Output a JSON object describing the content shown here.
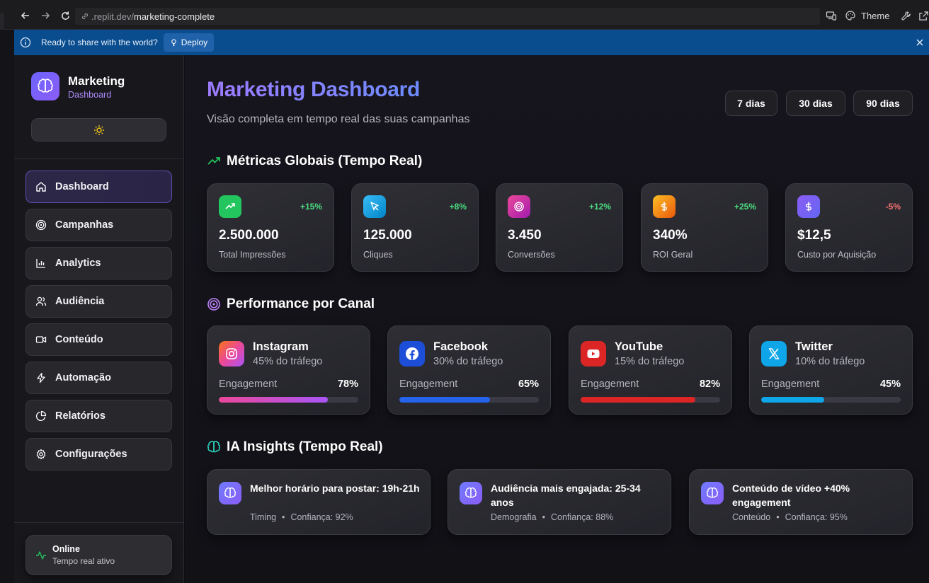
{
  "browser": {
    "url_prefix": ".replit.dev/",
    "url_path": "marketing-complete",
    "theme_label": "Theme"
  },
  "deploy_bar": {
    "message": "Ready to share with the world?",
    "button": "Deploy"
  },
  "sidebar": {
    "brand_title": "Marketing",
    "brand_subtitle": "Dashboard",
    "items": [
      {
        "label": "Dashboard",
        "icon": "home-icon",
        "active": true
      },
      {
        "label": "Campanhas",
        "icon": "target-icon"
      },
      {
        "label": "Analytics",
        "icon": "bar-chart-icon"
      },
      {
        "label": "Audiência",
        "icon": "users-icon"
      },
      {
        "label": "Conteúdo",
        "icon": "video-icon"
      },
      {
        "label": "Automação",
        "icon": "lightning-icon"
      },
      {
        "label": "Relatórios",
        "icon": "pie-chart-icon"
      },
      {
        "label": "Configurações",
        "icon": "gear-icon"
      }
    ],
    "status": {
      "title": "Online",
      "subtitle": "Tempo real ativo"
    }
  },
  "header": {
    "title": "Marketing Dashboard",
    "subtitle": "Visão completa em tempo real das suas campanhas",
    "ranges": [
      "7 dias",
      "30 dias",
      "90 dias"
    ]
  },
  "metrics": {
    "title": "Métricas Globais (Tempo Real)",
    "cards": [
      {
        "value": "2.500.000",
        "label": "Total Impressões",
        "change": "+15%",
        "icon": "trending-up-icon",
        "color": "#22c55e",
        "change_color": "#4ade80"
      },
      {
        "value": "125.000",
        "label": "Cliques",
        "change": "+8%",
        "icon": "cursor-icon",
        "color": "#0ea5e9",
        "change_color": "#4ade80"
      },
      {
        "value": "3.450",
        "label": "Conversões",
        "change": "+12%",
        "icon": "target-icon",
        "color": "#c026d3",
        "change_color": "#4ade80"
      },
      {
        "value": "340%",
        "label": "ROI Geral",
        "change": "+25%",
        "icon": "dollar-icon",
        "color": "#f59e0b",
        "change_color": "#4ade80"
      },
      {
        "value": "$12,5",
        "label": "Custo por Aquisição",
        "change": "-5%",
        "icon": "dollar-icon",
        "color": "#8b5cf6",
        "change_color": "#f87171"
      }
    ]
  },
  "channels": {
    "title": "Performance por Canal",
    "engagement_label": "Engagement",
    "cards": [
      {
        "name": "Instagram",
        "traffic": "45% do tráfego",
        "engagement": "78%",
        "engagement_value": 0.78,
        "icon": "instagram-icon",
        "bar_color": "#d946ef"
      },
      {
        "name": "Facebook",
        "traffic": "30% do tráfego",
        "engagement": "65%",
        "engagement_value": 0.65,
        "icon": "facebook-icon",
        "bar_color": "#2563eb"
      },
      {
        "name": "YouTube",
        "traffic": "15% do tráfego",
        "engagement": "82%",
        "engagement_value": 0.82,
        "icon": "youtube-icon",
        "bar_color": "#dc2626"
      },
      {
        "name": "Twitter",
        "traffic": "10% do tráfego",
        "engagement": "45%",
        "engagement_value": 0.45,
        "icon": "twitter-x-icon",
        "bar_color": "#0ea5e9"
      }
    ]
  },
  "insights": {
    "title": "IA Insights (Tempo Real)",
    "cards": [
      {
        "text": "Melhor horário para postar: 19h-21h",
        "category": "Timing",
        "confidence": "Confiança: 92%"
      },
      {
        "text": "Audiência mais engajada: 25-34 anos",
        "category": "Demografia",
        "confidence": "Confiança: 88%"
      },
      {
        "text": "Conteúdo de vídeo +40% engagement",
        "category": "Conteúdo",
        "confidence": "Confiança: 95%"
      }
    ]
  }
}
